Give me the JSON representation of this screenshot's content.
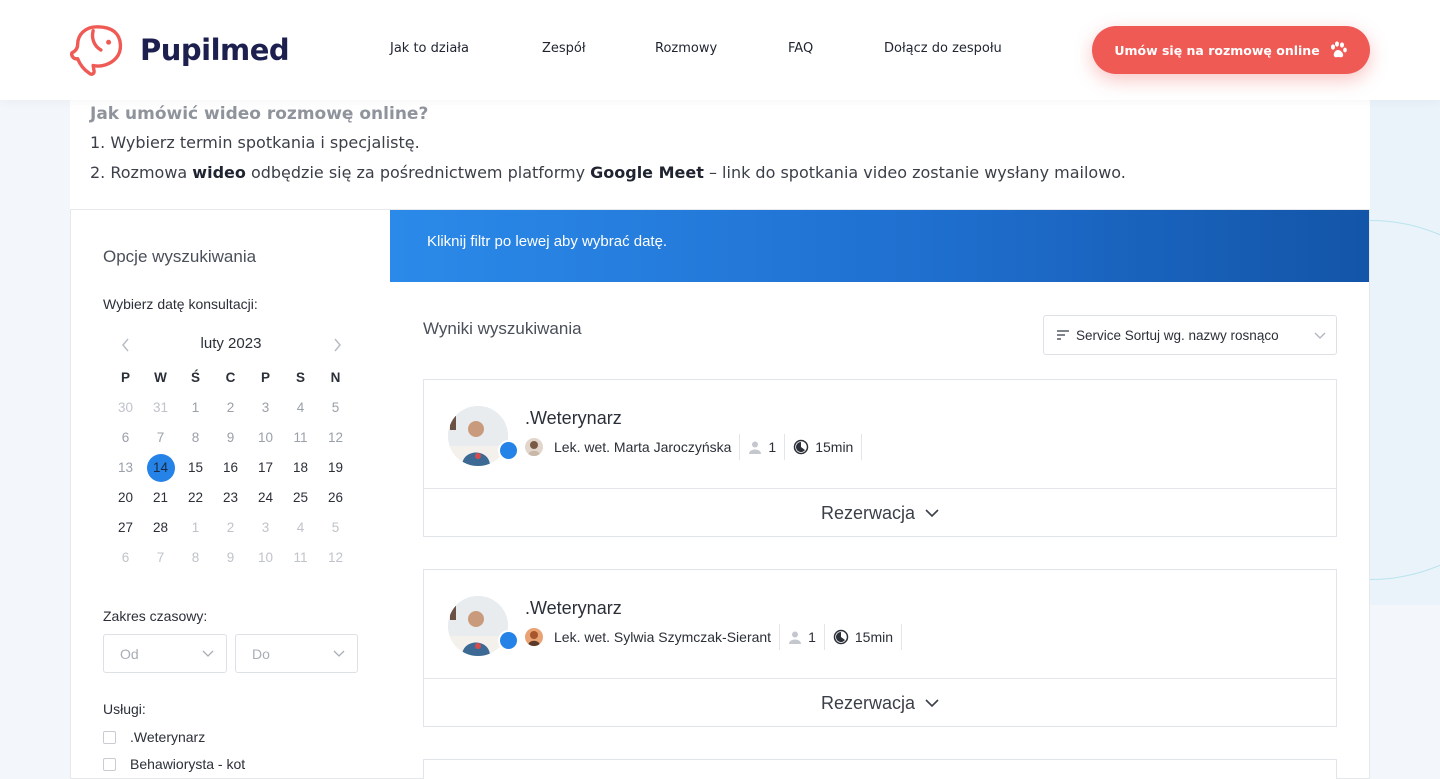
{
  "header": {
    "brand": "Pupilmed",
    "nav": [
      "Jak to działa",
      "Zespół",
      "Rozmowy",
      "FAQ",
      "Dołącz do zespołu"
    ],
    "cta_label": "Umów się na rozmowę online",
    "brand_color": "#ef5a55"
  },
  "info": {
    "title": "Jak umówić wideo rozmowę online?",
    "step1": "1. Wybierz termin spotkania i specjalistę.",
    "step2_prefix": "2. Rozmowa ",
    "step2_bold1": "wideo",
    "step2_mid": " odbędzie się za pośrednictwem platformy ",
    "step2_bold2": "Google Meet",
    "step2_suffix": " – link do spotkania video zostanie wysłany mailowo."
  },
  "sidebar": {
    "title": "Opcje wyszukiwania",
    "date_label": "Wybierz datę konsultacji:",
    "calendar": {
      "month": "luty 2023",
      "weekdays": [
        "P",
        "W",
        "Ś",
        "C",
        "P",
        "S",
        "N"
      ],
      "weeks": [
        [
          "30",
          "31",
          "1",
          "2",
          "3",
          "4",
          "5"
        ],
        [
          "6",
          "7",
          "8",
          "9",
          "10",
          "11",
          "12"
        ],
        [
          "13",
          "14",
          "15",
          "16",
          "17",
          "18",
          "19"
        ],
        [
          "20",
          "21",
          "22",
          "23",
          "24",
          "25",
          "26"
        ],
        [
          "27",
          "28",
          "1",
          "2",
          "3",
          "4",
          "5"
        ],
        [
          "6",
          "7",
          "8",
          "9",
          "10",
          "11",
          "12"
        ]
      ],
      "selected": "14"
    },
    "time_label": "Zakres czasowy:",
    "from_placeholder": "Od",
    "to_placeholder": "Do",
    "services_label": "Usługi:",
    "services": [
      ".Weterynarz",
      "Behawiorysta - kot"
    ]
  },
  "main": {
    "banner": "Kliknij filtr po lewej aby wybrać datę.",
    "results_title": "Wyniki wyszukiwania",
    "sort_label": "Service Sortuj wg. nazwy rosnąco",
    "accent_color": "#2583e8",
    "results": [
      {
        "service": ".Weterynarz",
        "doctor": "Lek. wet. Marta Jaroczyńska",
        "capacity": "1",
        "duration": "15min",
        "action": "Rezerwacja"
      },
      {
        "service": ".Weterynarz",
        "doctor": "Lek. wet. Sylwia Szymczak-Sierant",
        "capacity": "1",
        "duration": "15min",
        "action": "Rezerwacja"
      }
    ]
  }
}
